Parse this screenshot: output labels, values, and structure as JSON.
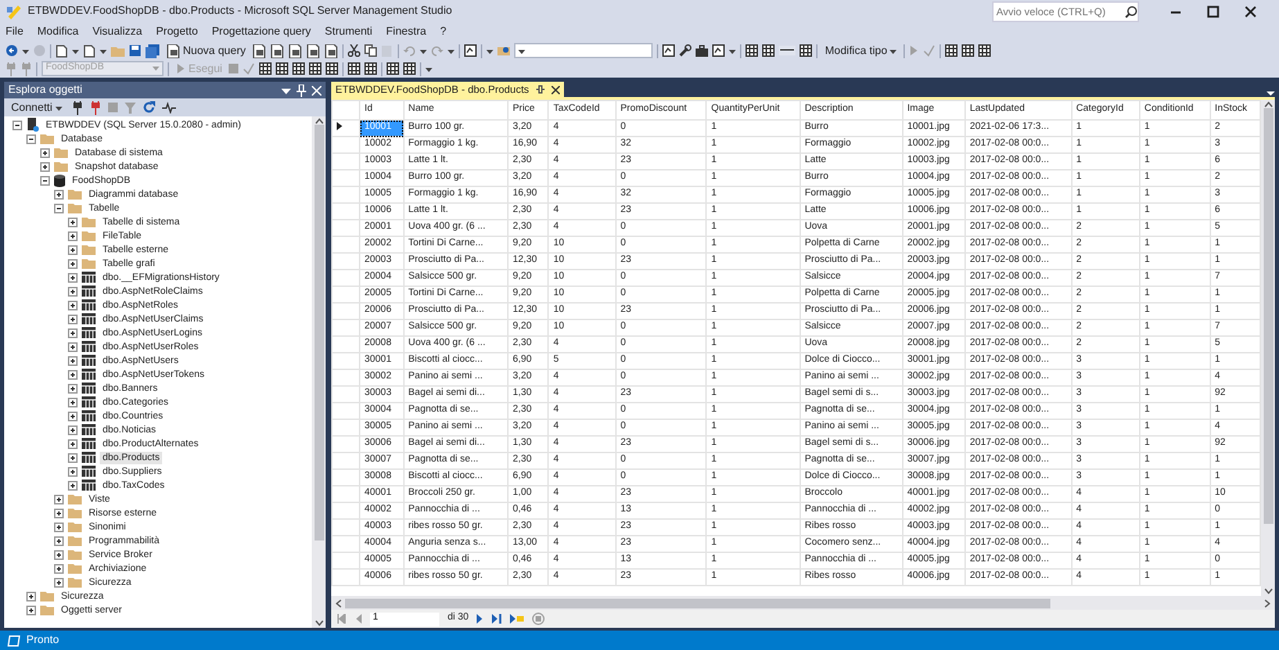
{
  "window": {
    "title": "ETBWDDEV.FoodShopDB - dbo.Products - Microsoft SQL Server Management Studio",
    "quick_launch": {
      "placeholder": "Avvio veloce (CTRL+Q)"
    }
  },
  "menu": [
    "File",
    "Modifica",
    "Visualizza",
    "Progetto",
    "Progettazione query",
    "Strumenti",
    "Finestra",
    "?"
  ],
  "toolbar": {
    "new_query": "Nuova query",
    "change_type": "Modifica tipo",
    "database_combo": {
      "value": "FoodShopDB",
      "disabled": true
    },
    "execute": {
      "label": "Esegui",
      "disabled": true
    }
  },
  "object_explorer": {
    "title": "Esplora oggetti",
    "connect": "Connetti",
    "tree": [
      {
        "label": "ETBWDDEV (SQL Server 15.0.2080 - admin)",
        "kind": "server",
        "expanded": true,
        "selected": false,
        "children": [
          {
            "label": "Database",
            "kind": "folder",
            "expanded": true,
            "selected": false,
            "children": [
              {
                "label": "Database di sistema",
                "kind": "folder",
                "expanded": false,
                "selected": false
              },
              {
                "label": "Snapshot database",
                "kind": "folder",
                "expanded": false,
                "selected": false
              },
              {
                "label": "FoodShopDB",
                "kind": "database",
                "expanded": true,
                "selected": false,
                "children": [
                  {
                    "label": "Diagrammi database",
                    "kind": "folder",
                    "expanded": false,
                    "selected": false
                  },
                  {
                    "label": "Tabelle",
                    "kind": "folder",
                    "expanded": true,
                    "selected": false,
                    "children": [
                      {
                        "label": "Tabelle di sistema",
                        "kind": "folder",
                        "expanded": false,
                        "selected": false
                      },
                      {
                        "label": "FileTable",
                        "kind": "folder",
                        "expanded": false,
                        "selected": false
                      },
                      {
                        "label": "Tabelle esterne",
                        "kind": "folder",
                        "expanded": false,
                        "selected": false
                      },
                      {
                        "label": "Tabelle grafi",
                        "kind": "folder",
                        "expanded": false,
                        "selected": false
                      },
                      {
                        "label": "dbo.__EFMigrationsHistory",
                        "kind": "table",
                        "expanded": false,
                        "selected": false
                      },
                      {
                        "label": "dbo.AspNetRoleClaims",
                        "kind": "table",
                        "expanded": false,
                        "selected": false
                      },
                      {
                        "label": "dbo.AspNetRoles",
                        "kind": "table",
                        "expanded": false,
                        "selected": false
                      },
                      {
                        "label": "dbo.AspNetUserClaims",
                        "kind": "table",
                        "expanded": false,
                        "selected": false
                      },
                      {
                        "label": "dbo.AspNetUserLogins",
                        "kind": "table",
                        "expanded": false,
                        "selected": false
                      },
                      {
                        "label": "dbo.AspNetUserRoles",
                        "kind": "table",
                        "expanded": false,
                        "selected": false
                      },
                      {
                        "label": "dbo.AspNetUsers",
                        "kind": "table",
                        "expanded": false,
                        "selected": false
                      },
                      {
                        "label": "dbo.AspNetUserTokens",
                        "kind": "table",
                        "expanded": false,
                        "selected": false
                      },
                      {
                        "label": "dbo.Banners",
                        "kind": "table",
                        "expanded": false,
                        "selected": false
                      },
                      {
                        "label": "dbo.Categories",
                        "kind": "table",
                        "expanded": false,
                        "selected": false
                      },
                      {
                        "label": "dbo.Countries",
                        "kind": "table",
                        "expanded": false,
                        "selected": false
                      },
                      {
                        "label": "dbo.Noticias",
                        "kind": "table",
                        "expanded": false,
                        "selected": false
                      },
                      {
                        "label": "dbo.ProductAlternates",
                        "kind": "table",
                        "expanded": false,
                        "selected": false
                      },
                      {
                        "label": "dbo.Products",
                        "kind": "table",
                        "expanded": false,
                        "selected": true
                      },
                      {
                        "label": "dbo.Suppliers",
                        "kind": "table",
                        "expanded": false,
                        "selected": false
                      },
                      {
                        "label": "dbo.TaxCodes",
                        "kind": "table",
                        "expanded": false,
                        "selected": false
                      }
                    ]
                  },
                  {
                    "label": "Viste",
                    "kind": "folder",
                    "expanded": false,
                    "selected": false
                  },
                  {
                    "label": "Risorse esterne",
                    "kind": "folder",
                    "expanded": false,
                    "selected": false
                  },
                  {
                    "label": "Sinonimi",
                    "kind": "folder",
                    "expanded": false,
                    "selected": false
                  },
                  {
                    "label": "Programmabilità",
                    "kind": "folder",
                    "expanded": false,
                    "selected": false
                  },
                  {
                    "label": "Service Broker",
                    "kind": "folder",
                    "expanded": false,
                    "selected": false
                  },
                  {
                    "label": "Archiviazione",
                    "kind": "folder",
                    "expanded": false,
                    "selected": false
                  },
                  {
                    "label": "Sicurezza",
                    "kind": "folder",
                    "expanded": false,
                    "selected": false
                  }
                ]
              }
            ]
          },
          {
            "label": "Sicurezza",
            "kind": "folder",
            "expanded": false,
            "selected": false
          },
          {
            "label": "Oggetti server",
            "kind": "folder",
            "expanded": false,
            "selected": false
          }
        ]
      }
    ]
  },
  "tabs": [
    {
      "label": "ETBWDDEV.FoodShopDB - dbo.Products",
      "selected": true
    }
  ],
  "grid": {
    "columns": [
      "Id",
      "Name",
      "Price",
      "TaxCodeId",
      "PromoDiscount",
      "QuantityPerUnit",
      "Description",
      "Image",
      "LastUpdated",
      "CategoryId",
      "ConditionId",
      "InStock"
    ],
    "rows": [
      {
        "selected": true,
        "cells": [
          "10001",
          "Burro 100 gr.",
          "3,20",
          "4",
          "0",
          "1",
          "Burro",
          "10001.jpg",
          "2021-02-06 17:3...",
          "1",
          "1",
          "2"
        ]
      },
      {
        "selected": false,
        "cells": [
          "10002",
          "Formaggio 1 kg.",
          "16,90",
          "4",
          "32",
          "1",
          "Formaggio",
          "10002.jpg",
          "2017-02-08 00:0...",
          "1",
          "1",
          "3"
        ]
      },
      {
        "selected": false,
        "cells": [
          "10003",
          "Latte 1 lt.",
          "2,30",
          "4",
          "23",
          "1",
          "Latte",
          "10003.jpg",
          "2017-02-08 00:0...",
          "1",
          "1",
          "6"
        ]
      },
      {
        "selected": false,
        "cells": [
          "10004",
          "Burro 100 gr.",
          "3,20",
          "4",
          "0",
          "1",
          "Burro",
          "10004.jpg",
          "2017-02-08 00:0...",
          "1",
          "1",
          "2"
        ]
      },
      {
        "selected": false,
        "cells": [
          "10005",
          "Formaggio 1 kg.",
          "16,90",
          "4",
          "32",
          "1",
          "Formaggio",
          "10005.jpg",
          "2017-02-08 00:0...",
          "1",
          "1",
          "3"
        ]
      },
      {
        "selected": false,
        "cells": [
          "10006",
          "Latte 1 lt.",
          "2,30",
          "4",
          "23",
          "1",
          "Latte",
          "10006.jpg",
          "2017-02-08 00:0...",
          "1",
          "1",
          "6"
        ]
      },
      {
        "selected": false,
        "cells": [
          "20001",
          "Uova 400 gr. (6 ...",
          "2,30",
          "4",
          "0",
          "1",
          "Uova",
          "20001.jpg",
          "2017-02-08 00:0...",
          "2",
          "1",
          "5"
        ]
      },
      {
        "selected": false,
        "cells": [
          "20002",
          "Tortini Di Carne...",
          "9,20",
          "10",
          "0",
          "1",
          "Polpetta di Carne",
          "20002.jpg",
          "2017-02-08 00:0...",
          "2",
          "1",
          "1"
        ]
      },
      {
        "selected": false,
        "cells": [
          "20003",
          "Prosciutto di Pa...",
          "12,30",
          "10",
          "23",
          "1",
          "Prosciutto di Pa...",
          "20003.jpg",
          "2017-02-08 00:0...",
          "2",
          "1",
          "1"
        ]
      },
      {
        "selected": false,
        "cells": [
          "20004",
          "Salsicce 500 gr.",
          "9,20",
          "10",
          "0",
          "1",
          "Salsicce",
          "20004.jpg",
          "2017-02-08 00:0...",
          "2",
          "1",
          "7"
        ]
      },
      {
        "selected": false,
        "cells": [
          "20005",
          "Tortini Di Carne...",
          "9,20",
          "10",
          "0",
          "1",
          "Polpetta di Carne",
          "20005.jpg",
          "2017-02-08 00:0...",
          "2",
          "1",
          "1"
        ]
      },
      {
        "selected": false,
        "cells": [
          "20006",
          "Prosciutto di Pa...",
          "12,30",
          "10",
          "23",
          "1",
          "Prosciutto di Pa...",
          "20006.jpg",
          "2017-02-08 00:0...",
          "2",
          "1",
          "1"
        ]
      },
      {
        "selected": false,
        "cells": [
          "20007",
          "Salsicce 500 gr.",
          "9,20",
          "10",
          "0",
          "1",
          "Salsicce",
          "20007.jpg",
          "2017-02-08 00:0...",
          "2",
          "1",
          "7"
        ]
      },
      {
        "selected": false,
        "cells": [
          "20008",
          "Uova 400 gr. (6 ...",
          "2,30",
          "4",
          "0",
          "1",
          "Uova",
          "20008.jpg",
          "2017-02-08 00:0...",
          "2",
          "1",
          "5"
        ]
      },
      {
        "selected": false,
        "cells": [
          "30001",
          "Biscotti al ciocc...",
          "6,90",
          "5",
          "0",
          "1",
          "Dolce di Ciocco...",
          "30001.jpg",
          "2017-02-08 00:0...",
          "3",
          "1",
          "1"
        ]
      },
      {
        "selected": false,
        "cells": [
          "30002",
          "Panino ai semi ...",
          "3,20",
          "4",
          "0",
          "1",
          "Panino ai semi ...",
          "30002.jpg",
          "2017-02-08 00:0...",
          "3",
          "1",
          "4"
        ]
      },
      {
        "selected": false,
        "cells": [
          "30003",
          "Bagel ai semi di...",
          "1,30",
          "4",
          "23",
          "1",
          "Bagel semi di s...",
          "30003.jpg",
          "2017-02-08 00:0...",
          "3",
          "1",
          "92"
        ]
      },
      {
        "selected": false,
        "cells": [
          "30004",
          "Pagnotta di se...",
          "2,30",
          "4",
          "0",
          "1",
          "Pagnotta di se...",
          "30004.jpg",
          "2017-02-08 00:0...",
          "3",
          "1",
          "1"
        ]
      },
      {
        "selected": false,
        "cells": [
          "30005",
          "Panino ai semi ...",
          "3,20",
          "4",
          "0",
          "1",
          "Panino ai semi ...",
          "30005.jpg",
          "2017-02-08 00:0...",
          "3",
          "1",
          "4"
        ]
      },
      {
        "selected": false,
        "cells": [
          "30006",
          "Bagel ai semi di...",
          "1,30",
          "4",
          "23",
          "1",
          "Bagel semi di s...",
          "30006.jpg",
          "2017-02-08 00:0...",
          "3",
          "1",
          "92"
        ]
      },
      {
        "selected": false,
        "cells": [
          "30007",
          "Pagnotta di se...",
          "2,30",
          "4",
          "0",
          "1",
          "Pagnotta di se...",
          "30007.jpg",
          "2017-02-08 00:0...",
          "3",
          "1",
          "1"
        ]
      },
      {
        "selected": false,
        "cells": [
          "30008",
          "Biscotti al ciocc...",
          "6,90",
          "4",
          "0",
          "1",
          "Dolce di Ciocco...",
          "30008.jpg",
          "2017-02-08 00:0...",
          "3",
          "1",
          "1"
        ]
      },
      {
        "selected": false,
        "cells": [
          "40001",
          "Broccoli 250 gr.",
          "1,00",
          "4",
          "23",
          "1",
          "Broccolo",
          "40001.jpg",
          "2017-02-08 00:0...",
          "4",
          "1",
          "10"
        ]
      },
      {
        "selected": false,
        "cells": [
          "40002",
          "Pannocchia di ...",
          "0,46",
          "4",
          "13",
          "1",
          "Pannocchia di ...",
          "40002.jpg",
          "2017-02-08 00:0...",
          "4",
          "1",
          "0"
        ]
      },
      {
        "selected": false,
        "cells": [
          "40003",
          "ribes rosso 50 gr.",
          "2,30",
          "4",
          "23",
          "1",
          "Ribes rosso",
          "40003.jpg",
          "2017-02-08 00:0...",
          "4",
          "1",
          "1"
        ]
      },
      {
        "selected": false,
        "cells": [
          "40004",
          "Anguria senza s...",
          "13,00",
          "4",
          "23",
          "1",
          "Cocomero senz...",
          "40004.jpg",
          "2017-02-08 00:0...",
          "4",
          "1",
          "4"
        ]
      },
      {
        "selected": false,
        "cells": [
          "40005",
          "Pannocchia di ...",
          "0,46",
          "4",
          "13",
          "1",
          "Pannocchia di ...",
          "40005.jpg",
          "2017-02-08 00:0...",
          "4",
          "1",
          "0"
        ]
      },
      {
        "selected": false,
        "cells": [
          "40006",
          "ribes rosso 50 gr.",
          "2,30",
          "4",
          "23",
          "1",
          "Ribes rosso",
          "40006.jpg",
          "2017-02-08 00:0...",
          "4",
          "1",
          "1"
        ]
      }
    ]
  },
  "pager": {
    "page": "1",
    "total": "di 30"
  },
  "status_bar": "Pronto"
}
